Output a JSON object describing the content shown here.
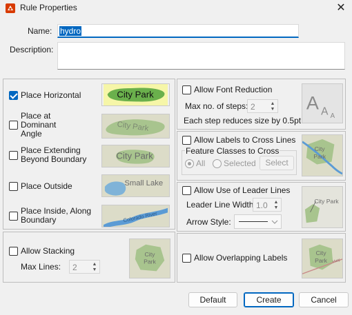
{
  "window": {
    "title": "Rule Properties",
    "close_glyph": "✕"
  },
  "name": {
    "label": "Name:",
    "value": "hydro"
  },
  "description": {
    "label": "Description:",
    "value": ""
  },
  "placement": [
    {
      "label_lines": [
        "Place Horizontal"
      ],
      "checked": true,
      "preview_text": "City Park"
    },
    {
      "label_lines": [
        "Place at",
        "Dominant",
        "Angle"
      ],
      "checked": false,
      "preview_text": "City Park"
    },
    {
      "label_lines": [
        "Place Extending",
        "Beyond Boundary"
      ],
      "checked": false,
      "preview_text": "City Park"
    },
    {
      "label_lines": [
        "Place Outside"
      ],
      "checked": false,
      "preview_text": "Small Lake"
    },
    {
      "label_lines": [
        "Place Inside, Along",
        "Boundary"
      ],
      "checked": false,
      "preview_text": "Colorado River"
    }
  ],
  "stacking": {
    "label": "Allow Stacking",
    "checked": false,
    "max_lines_label": "Max Lines:",
    "max_lines_value": "2",
    "preview_text_1": "City",
    "preview_text_2": "Park"
  },
  "font_reduction": {
    "label": "Allow Font Reduction",
    "checked": false,
    "steps_label": "Max no. of steps:",
    "steps_value": "2",
    "note": "Each step reduces size by 0.5pt.",
    "preview_letters": [
      "A",
      "A",
      "A"
    ]
  },
  "cross_lines": {
    "label": "Allow Labels to Cross Lines",
    "checked": false,
    "group_label": "Feature Classes to Cross",
    "radio_all": "All",
    "radio_selected": "Selected",
    "select_button": "Select",
    "preview_text_1": "City",
    "preview_text_2": "Park"
  },
  "leader_lines": {
    "label": "Allow Use of Leader Lines",
    "checked": false,
    "width_label": "Leader Line Width:",
    "width_value": "1.0",
    "arrow_label": "Arrow Style:",
    "preview_text": "City Park"
  },
  "overlap": {
    "label": "Allow Overlapping Labels",
    "checked": false,
    "preview_text_1": "City",
    "preview_text_2": "Park",
    "preview_road": "Hwy"
  },
  "buttons": {
    "default": "Default",
    "create": "Create",
    "cancel": "Cancel"
  },
  "colors": {
    "accent": "#0067c0",
    "park_green": "#6ab04c",
    "park_faded": "#a8c48e",
    "water_blue": "#5b9bd5",
    "thumb_bg": "#dcdcc8"
  }
}
